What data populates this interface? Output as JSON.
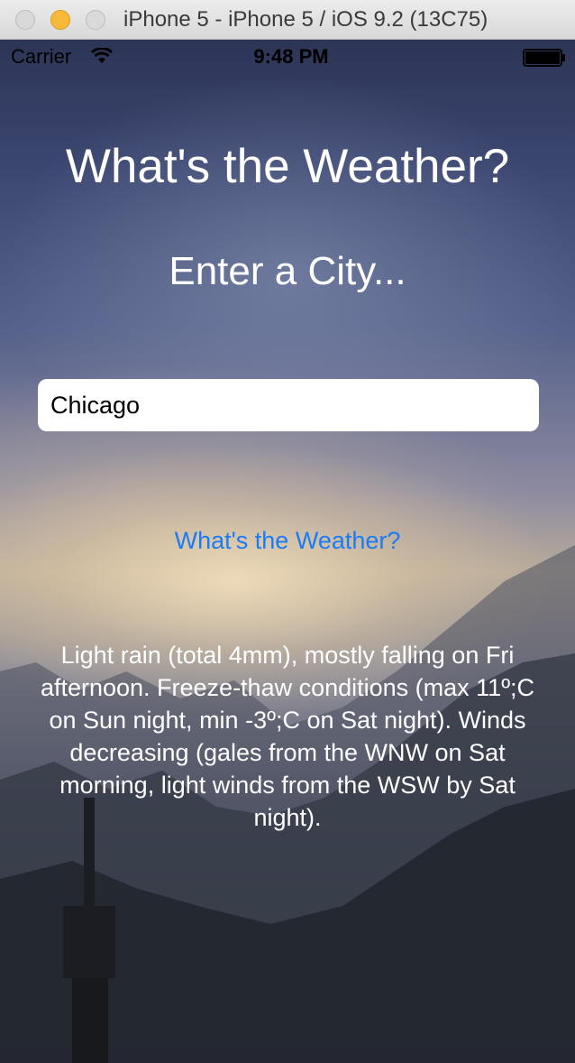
{
  "window": {
    "title": "iPhone 5 - iPhone 5 / iOS 9.2 (13C75)",
    "traffic_light_colors": {
      "close": "#d9d9d9",
      "minimize": "#f6b93a",
      "zoom": "#d9d9d9"
    }
  },
  "status_bar": {
    "carrier": "Carrier",
    "time": "9:48 PM",
    "wifi_icon": "wifi-icon",
    "battery_icon": "battery-icon"
  },
  "app": {
    "title": "What's the Weather?",
    "subtitle": "Enter a City...",
    "city_input": {
      "value": "Chicago"
    },
    "button_label": "What's the Weather?",
    "forecast": "Light rain (total 4mm), mostly falling on Fri afternoon. Freeze-thaw conditions (max 11º;C on Sun night, min -3º;C on Sat night). Winds decreasing (gales from the WNW on Sat morning, light winds from the WSW by Sat night).",
    "accent_color": "#1a7cf5"
  }
}
